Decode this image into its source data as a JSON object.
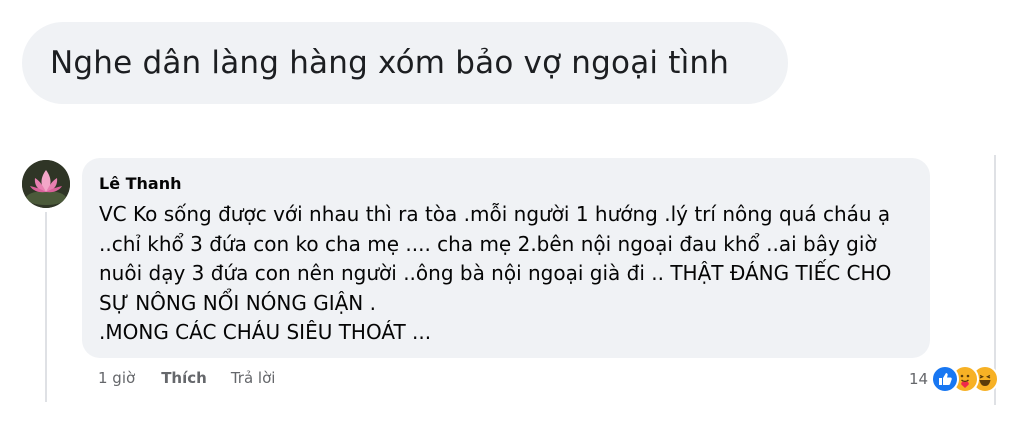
{
  "post": {
    "text": "Nghe dân làng hàng xóm bảo vợ ngoại tình"
  },
  "comment": {
    "author": "Lê Thanh",
    "lines": [
      "VC Ko sống được với nhau thì ra tòa .mỗi người 1 hướng .lý trí nông quá cháu ạ",
      "..chỉ khổ 3 đứa con ko cha mẹ .... cha mẹ 2.bên nội ngoại đau khổ ..ai bây giờ",
      "nuôi dạy 3 đứa con nên người ..ông bà nội ngoại già đi .. THẬT ĐÁNG TIẾC CHO",
      "SỰ NÔNG NỔI NÓNG GIẬN .",
      ".MONG CÁC CHÁU SIÊU THOÁT ..."
    ],
    "time": "1 giờ",
    "like_label": "Thích",
    "reply_label": "Trả lời",
    "reaction_count": "14",
    "reactions": [
      "like-icon",
      "care-icon",
      "haha-icon"
    ]
  },
  "colors": {
    "bubble_bg": "#f0f2f5",
    "text": "#050505",
    "meta": "#65676b",
    "like_blue": "#1877f2",
    "emoji_yellow": "#f7b125"
  }
}
